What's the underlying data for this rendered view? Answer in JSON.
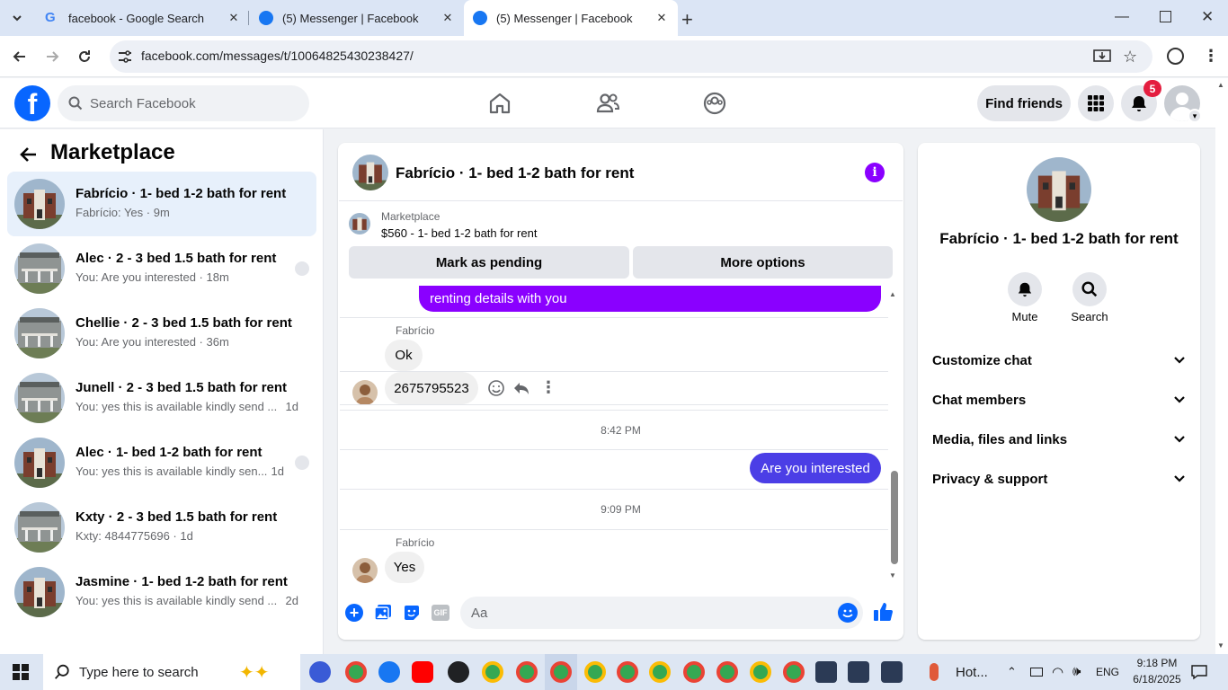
{
  "browser": {
    "tabs": [
      {
        "title": "facebook - Google Search"
      },
      {
        "title": "(5) Messenger | Facebook"
      },
      {
        "title": "(5) Messenger | Facebook"
      }
    ],
    "url": "facebook.com/messages/t/10064825430238427/"
  },
  "fb_header": {
    "search_placeholder": "Search Facebook",
    "find_friends": "Find friends",
    "notification_count": "5"
  },
  "left": {
    "title": "Marketplace",
    "conversations": [
      {
        "title": "Fabrício · 1- bed 1-2 bath for rent",
        "subtitle": "Fabrício: Yes · 9m",
        "when": ""
      },
      {
        "title": "Alec · 2 - 3 bed 1.5 bath for rent",
        "subtitle": "You: Are you interested · 18m",
        "when": ""
      },
      {
        "title": "Chellie · 2 - 3 bed 1.5 bath for rent",
        "subtitle": "You: Are you interested · 36m",
        "when": ""
      },
      {
        "title": "Junell · 2 - 3 bed 1.5 bath for rent",
        "subtitle": "You: yes this is available kindly send ...",
        "when": "1d"
      },
      {
        "title": "Alec · 1- bed 1-2 bath for rent",
        "subtitle": "You: yes this is available kindly sen...",
        "when": "1d"
      },
      {
        "title": "Kxty · 2 - 3 bed 1.5 bath for rent",
        "subtitle": "Kxty: 4844775696 · 1d",
        "when": ""
      },
      {
        "title": "Jasmine · 1- bed 1-2 bath for rent",
        "subtitle": "You: yes this is available kindly send ...",
        "when": "2d"
      }
    ]
  },
  "chat": {
    "title": "Fabrício · 1- bed 1-2 bath for rent",
    "marketplace_label": "Marketplace",
    "listing": "$560 - 1- bed 1-2 bath for rent",
    "mark_pending": "Mark as pending",
    "more_options": "More options",
    "messages": {
      "partial_out": "renting details with you",
      "sender1": "Fabrício",
      "in1": "Ok",
      "in2": "2675795523",
      "time1": "8:42 PM",
      "out1": "Are you interested",
      "time2": "9:09 PM",
      "sender2": "Fabrício",
      "in3": "Yes"
    },
    "composer_placeholder": "Aa",
    "accent": "#8a00ff"
  },
  "info": {
    "name": "Fabrício · 1- bed 1-2 bath for rent",
    "mute": "Mute",
    "search": "Search",
    "sections": [
      "Customize chat",
      "Chat members",
      "Media, files and links",
      "Privacy & support"
    ]
  },
  "taskbar": {
    "search_placeholder": "Type here to search",
    "hot_label": "Hot...",
    "lang": "ENG",
    "time": "9:18 PM",
    "date": "6/18/2025"
  }
}
